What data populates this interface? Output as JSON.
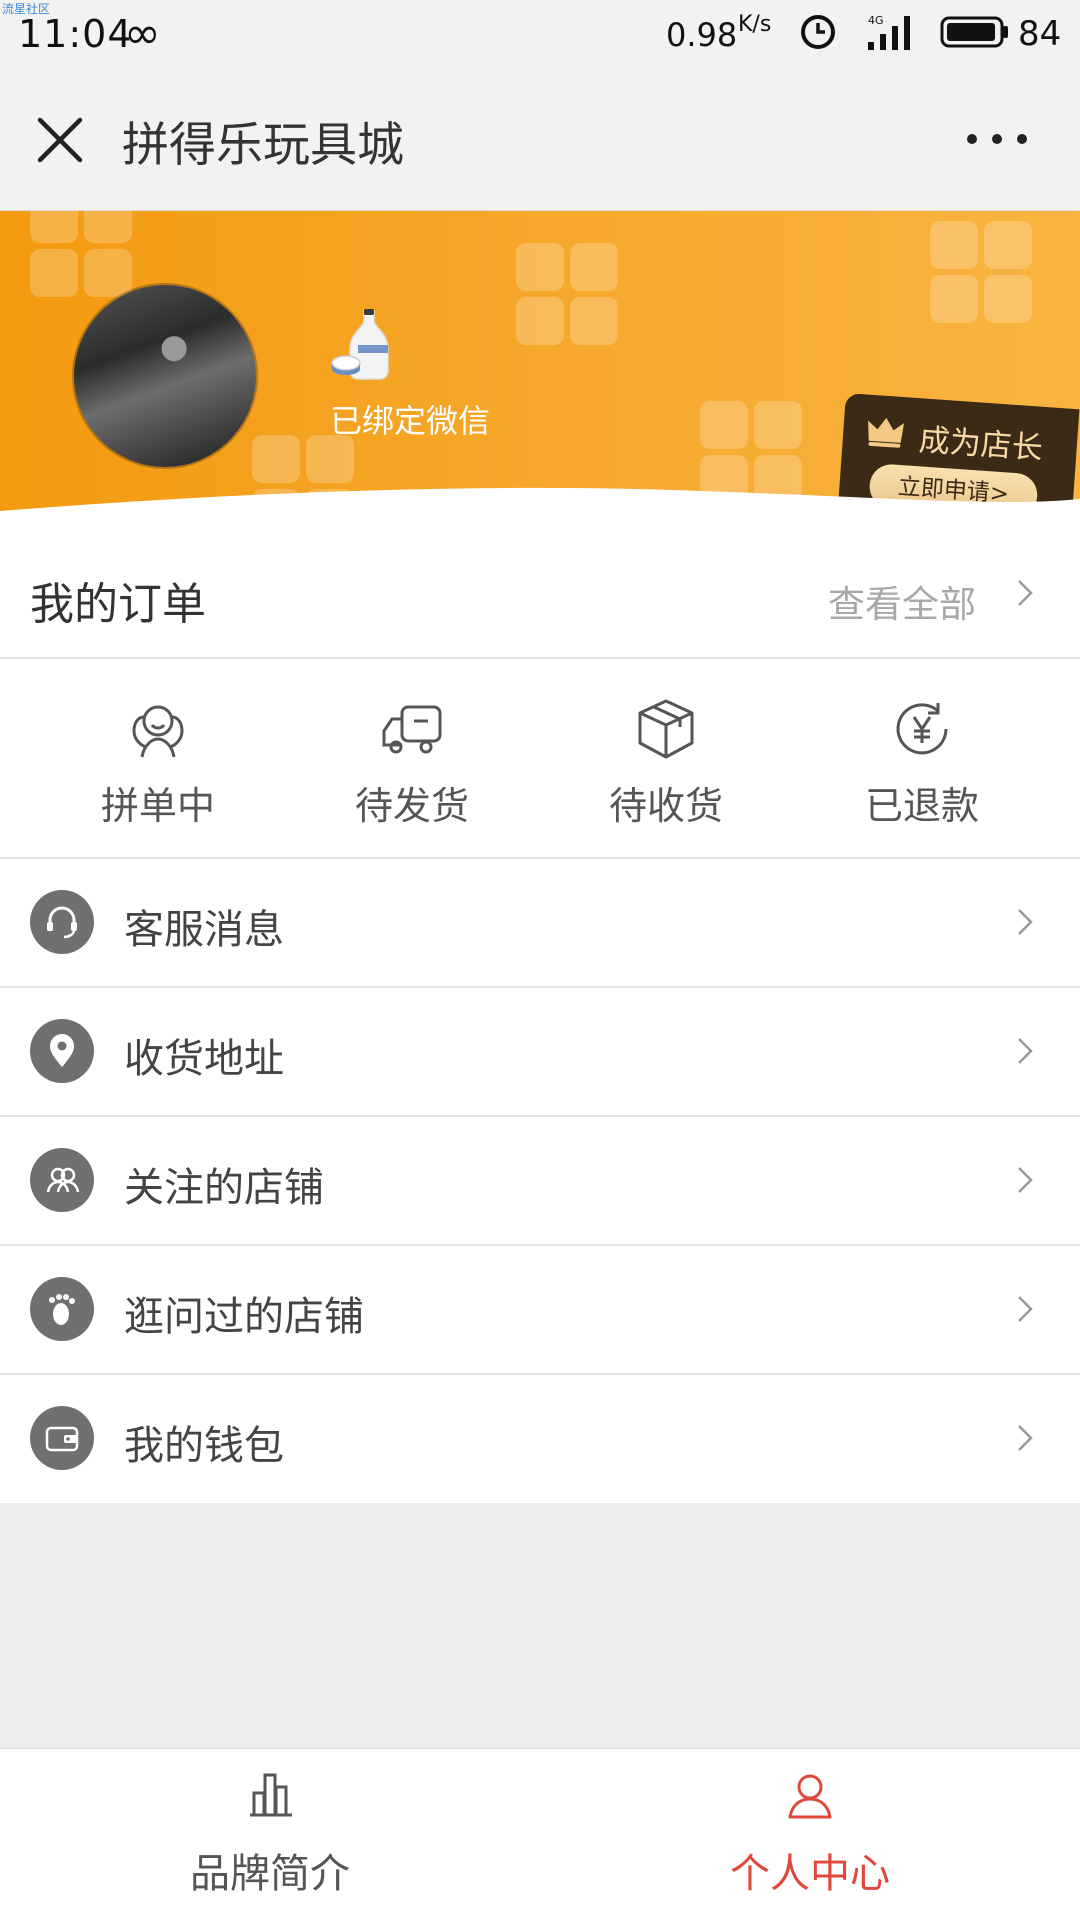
{
  "status_bar": {
    "watermark": "流星社区",
    "time": "11:04",
    "speed": "0.98",
    "speed_unit": "K/s",
    "battery": "84"
  },
  "navbar": {
    "title": "拼得乐玩具城"
  },
  "profile": {
    "bind_status": "已绑定微信",
    "shop_owner": {
      "title": "成为店长",
      "apply": "立即申请>"
    }
  },
  "orders": {
    "title": "我的订单",
    "view_all": "查看全部",
    "statuses": [
      {
        "label": "拼单中",
        "icon": "group-person-icon"
      },
      {
        "label": "待发货",
        "icon": "truck-icon"
      },
      {
        "label": "待收货",
        "icon": "box-icon"
      },
      {
        "label": "已退款",
        "icon": "refund-yen-icon"
      }
    ]
  },
  "menu": [
    {
      "label": "客服消息",
      "icon": "headset-icon"
    },
    {
      "label": "收货地址",
      "icon": "location-pin-icon"
    },
    {
      "label": "关注的店铺",
      "icon": "people-icon"
    },
    {
      "label": "逛问过的店铺",
      "icon": "footprint-icon"
    },
    {
      "label": "我的钱包",
      "icon": "wallet-icon"
    }
  ],
  "tabbar": {
    "tabs": [
      {
        "label": "品牌简介",
        "icon": "bar-chart-icon",
        "active": false
      },
      {
        "label": "个人中心",
        "icon": "user-icon",
        "active": true
      }
    ]
  },
  "colors": {
    "banner": "#f39a10",
    "active_tab": "#e0483b",
    "inactive_tab": "#555555"
  }
}
